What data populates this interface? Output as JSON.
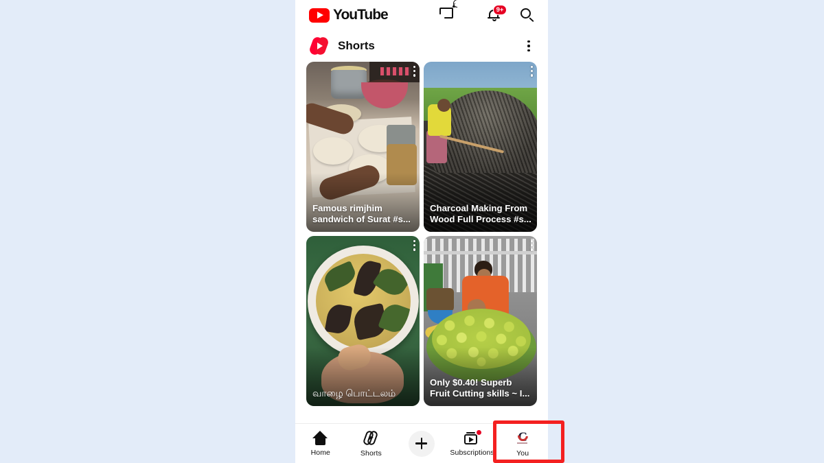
{
  "app": {
    "brand": "YouTube",
    "brand_color": "#ff0000",
    "background_color": "#e3ecf9"
  },
  "appbar": {
    "logo_name": "youtube-logo",
    "actions": [
      {
        "name": "cast-icon",
        "label": "Cast"
      },
      {
        "name": "notifications-icon",
        "label": "Notifications",
        "badge": "9+"
      },
      {
        "name": "search-icon",
        "label": "Search"
      }
    ]
  },
  "shorts_header": {
    "logo_name": "shorts-logo",
    "title": "Shorts",
    "menu_name": "more-options-icon"
  },
  "shorts": [
    {
      "title": "Famous rimjhim sandwich of Surat #s...",
      "thumb": "sandwich-preparation",
      "menu": "video-more-options-icon"
    },
    {
      "title": "Charcoal Making From Wood Full Process #s...",
      "thumb": "charcoal-mound",
      "menu": "video-more-options-icon"
    },
    {
      "title": "வாழை பொட்டலம்",
      "thumb": "banana-leaf-plate",
      "menu": "video-more-options-icon"
    },
    {
      "title": "Only $0.40! Superb Fruit Cutting skills ~ I...",
      "thumb": "fruit-seller-tray",
      "menu": "video-more-options-icon"
    }
  ],
  "bottom_nav": {
    "items": [
      {
        "label": "Home",
        "icon": "home-icon"
      },
      {
        "label": "Shorts",
        "icon": "shorts-icon"
      },
      {
        "label": "",
        "icon": "create-plus-icon"
      },
      {
        "label": "Subscriptions",
        "icon": "subscriptions-icon",
        "has_dot": true
      },
      {
        "label": "You",
        "icon": "account-avatar"
      }
    ],
    "highlighted": "You"
  },
  "annotation": {
    "name": "highlight-box-you",
    "color": "#f42020"
  }
}
